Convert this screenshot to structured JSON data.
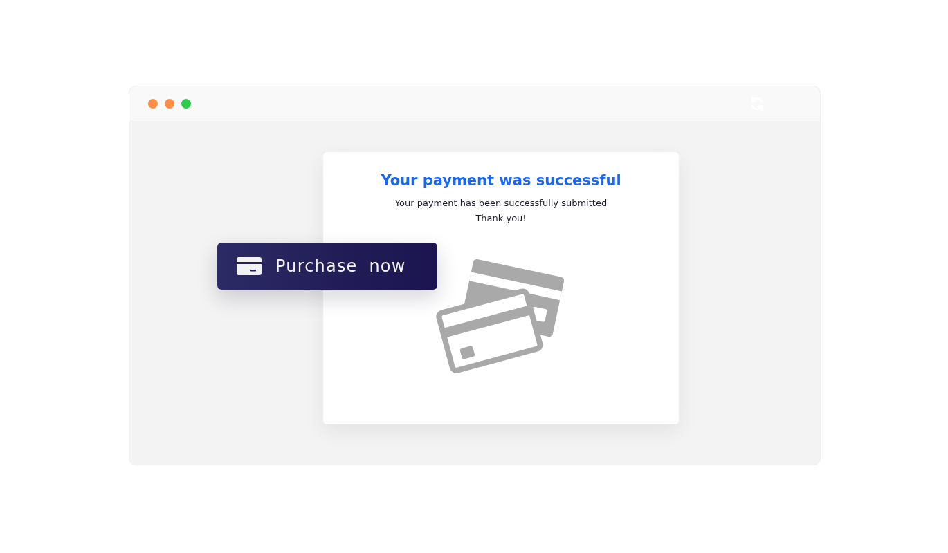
{
  "window": {
    "controls": [
      {
        "color": "#ff8f45"
      },
      {
        "color": "#ff8f45"
      },
      {
        "color": "#2ecc4a"
      }
    ]
  },
  "card": {
    "title": "Your payment was successful",
    "message": [
      "Your payment has been successfully submitted",
      "Thank you!"
    ]
  },
  "button": {
    "label": "Purchase now"
  }
}
